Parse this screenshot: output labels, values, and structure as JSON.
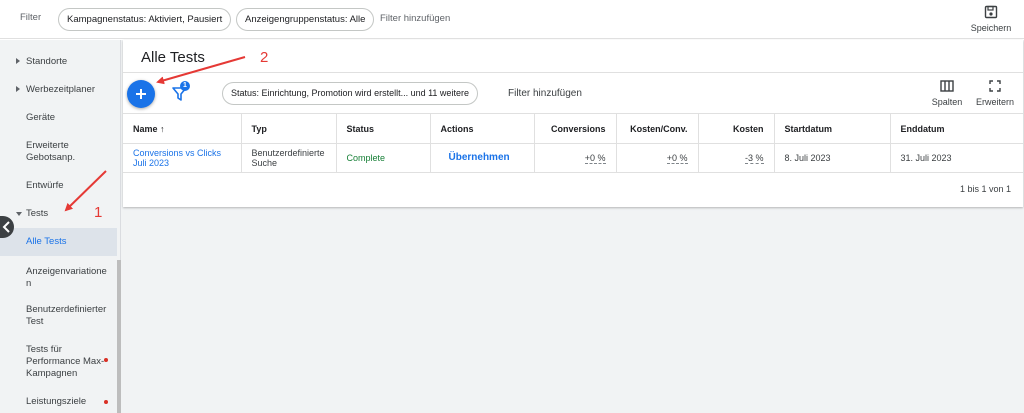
{
  "topbar": {
    "filter_label": "Filter",
    "chips": [
      "Kampagnenstatus: Aktiviert, Pausiert",
      "Anzeigengruppenstatus: Alle"
    ],
    "add_filter": "Filter hinzufügen",
    "save_label": "Speichern",
    "save_icon": "save-icon"
  },
  "sidebar": {
    "items": [
      {
        "label": "Standorte",
        "expander": "collapsed"
      },
      {
        "label": "Werbezeitplaner",
        "expander": "collapsed"
      },
      {
        "label": "Geräte"
      },
      {
        "label": "Erweiterte Gebotsanp."
      },
      {
        "label": "Entwürfe"
      },
      {
        "label": "Tests",
        "expander": "expanded"
      },
      {
        "label": "Alle Tests",
        "active": true
      },
      {
        "label": "Anzeigenvariationen"
      },
      {
        "label": "Benutzerdefinierter Test"
      },
      {
        "label": "Tests für Performance Max-Kampagnen",
        "dot": true
      },
      {
        "label": "Leistungsziele",
        "dot": true
      }
    ]
  },
  "main": {
    "title": "Alle Tests",
    "add_icon": "plus-icon",
    "filter_icon": "funnel-icon",
    "filter_badge": "1",
    "status_chip": "Status: Einrichtung, Promotion wird erstellt... und 11 weitere",
    "add_filter": "Filter hinzufügen",
    "columns_label": "Spalten",
    "expand_label": "Erweitern",
    "table": {
      "headers": [
        "Name",
        "Typ",
        "Status",
        "Actions",
        "Conversions",
        "Kosten/Conv.",
        "Kosten",
        "Startdatum",
        "Enddatum"
      ],
      "sort_icon": "arrow-up-icon",
      "rows": [
        {
          "name": "Conversions vs Clicks Juli 2023",
          "type": "Benutzerdefinierte Suche",
          "status": "Complete",
          "action": "Übernehmen",
          "conversions": "+0 %",
          "cost_per_conv": "+0 %",
          "cost": "-3 %",
          "start": "8. Juli 2023",
          "end": "31. Juli 2023"
        }
      ]
    },
    "pagination": "1 bis 1 von 1"
  },
  "annotations": {
    "label_1": "1",
    "label_2": "2",
    "color": "#e53935"
  },
  "colors": {
    "accent": "#1a73e8",
    "status_complete": "#188038",
    "sidebar_bg": "#f1f3f4"
  }
}
